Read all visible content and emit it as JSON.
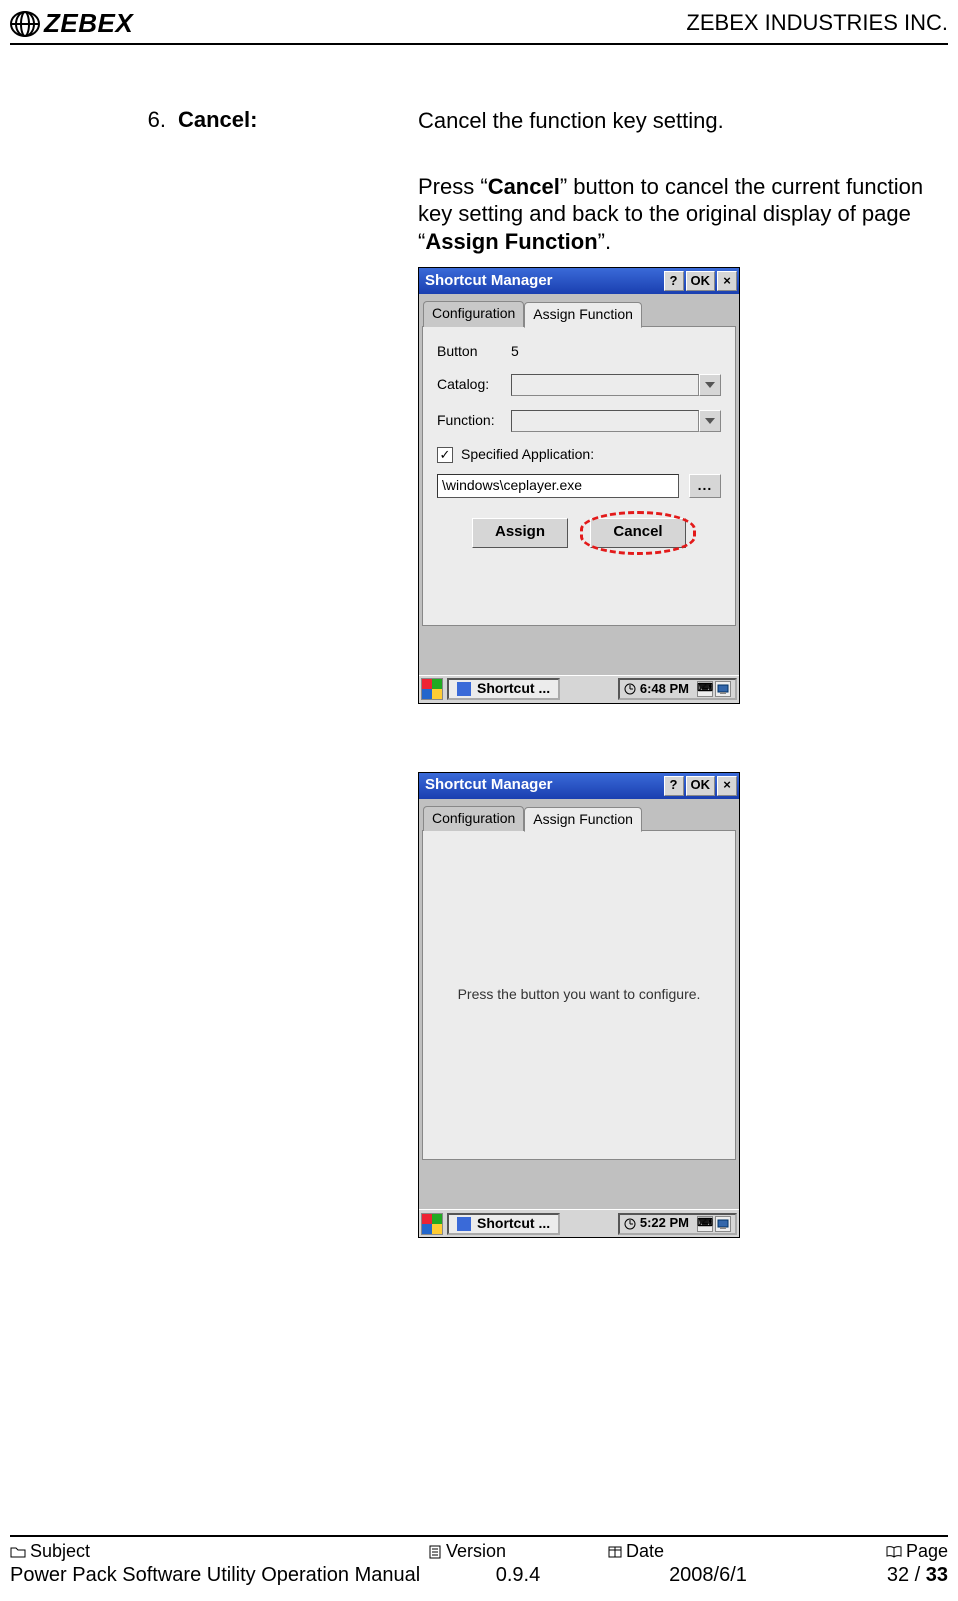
{
  "header": {
    "logo_text": "ZEBEX",
    "company": "ZEBEX INDUSTRIES INC."
  },
  "section": {
    "number": "6.",
    "label": "Cancel:",
    "desc1": "Cancel the function key setting.",
    "p2_a": "Press “",
    "p2_bold1": "Cancel",
    "p2_b": "” button to cancel the current function key setting and back to the original display of page “",
    "p2_bold2": "Assign Function",
    "p2_c": "”."
  },
  "win1": {
    "title": "Shortcut Manager",
    "help": "?",
    "ok": "OK",
    "close": "×",
    "tab_config": "Configuration",
    "tab_assign": "Assign Function",
    "btn_label": "Button",
    "btn_num": "5",
    "catalog_label": "Catalog:",
    "function_label": "Function:",
    "spec_app": "Specified Application:",
    "path": "\\windows\\ceplayer.exe",
    "browse": "...",
    "assign_btn": "Assign",
    "cancel_btn": "Cancel",
    "task_app": "Shortcut ...",
    "clock": "6:48 PM",
    "tray_kb": "⌨",
    "chk": "✓"
  },
  "win2": {
    "title": "Shortcut Manager",
    "help": "?",
    "ok": "OK",
    "close": "×",
    "tab_config": "Configuration",
    "tab_assign": "Assign Function",
    "prompt": "Press the button you want to configure.",
    "task_app": "Shortcut ...",
    "clock": "5:22 PM",
    "tray_kb": "⌨"
  },
  "footer": {
    "h_subject": "Subject",
    "h_version": "Version",
    "h_date": "Date",
    "h_page": "Page",
    "subject": "Power Pack Software Utility Operation Manual",
    "version": "0.9.4",
    "date": "2008/6/1",
    "page_cur": "32 / ",
    "page_total": "33"
  }
}
